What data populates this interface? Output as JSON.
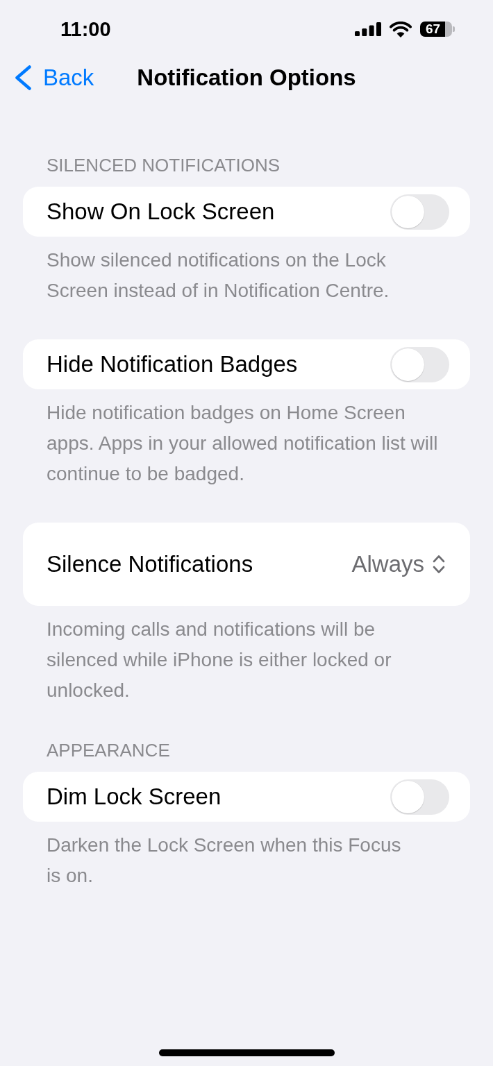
{
  "status_bar": {
    "time": "11:00",
    "battery": "67"
  },
  "nav_bar": {
    "back": "Back",
    "title": "Notification Options"
  },
  "sections": [
    {
      "header": "SILENCED NOTIFICATIONS",
      "rows": [
        {
          "kind": "toggle",
          "label": "Show On Lock Screen",
          "on": false
        }
      ],
      "footer": "Show silenced notifications on the Lock Screen instead of in Notification Centre."
    },
    {
      "rows": [
        {
          "kind": "toggle",
          "label": "Hide Notification Badges",
          "on": false
        }
      ],
      "footer": "Hide notification badges on Home Screen apps. Apps in your allowed notification list will continue to be badged."
    },
    {
      "rows": [
        {
          "kind": "menu",
          "label": "Silence Notifications",
          "value": "Always"
        }
      ],
      "footer": "Incoming calls and notifications will be silenced while iPhone is either locked or unlocked."
    },
    {
      "header": "APPEARANCE",
      "rows": [
        {
          "kind": "toggle",
          "label": "Dim Lock Screen",
          "on": false
        }
      ],
      "footer": "Darken the Lock Screen when this Focus is on."
    }
  ]
}
